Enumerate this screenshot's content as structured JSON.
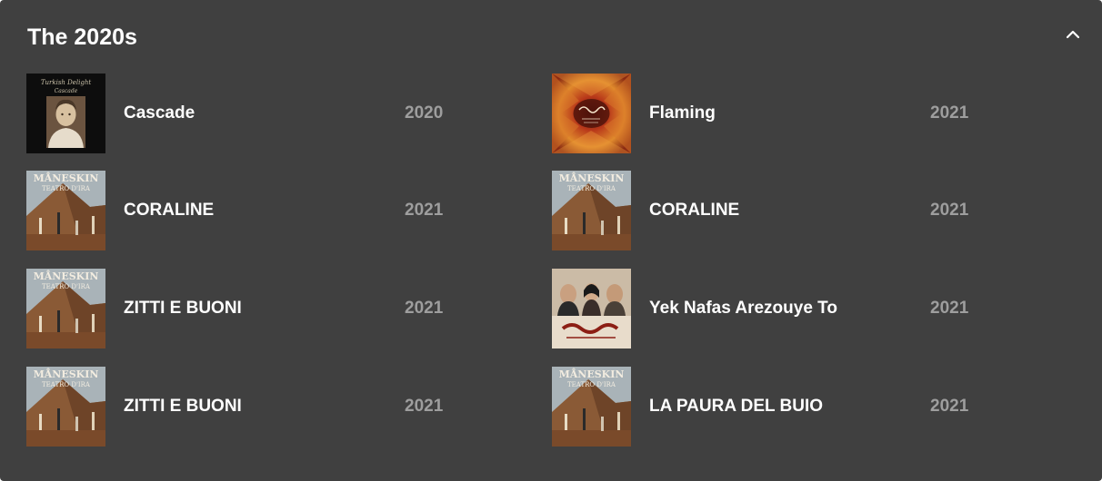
{
  "section": {
    "title": "The 2020s",
    "collapse_icon": "chevron-up-icon"
  },
  "colors": {
    "panel_bg": "#404040",
    "title_text": "#ffffff",
    "year_text": "#9e9e9e"
  },
  "tracks": [
    {
      "title": "Cascade",
      "year": "2020",
      "cover": "turkish-delight-cover",
      "cover_text_1": "Turkish Delight",
      "cover_text_2": "Cascade"
    },
    {
      "title": "Flaming",
      "year": "2021",
      "cover": "flaming-cover"
    },
    {
      "title": "CORALINE",
      "year": "2021",
      "cover": "maneskin-teatro-dira-cover",
      "cover_text_1": "MÅNESKIN",
      "cover_text_2": "TEATRO D'IRA"
    },
    {
      "title": "CORALINE",
      "year": "2021",
      "cover": "maneskin-teatro-dira-cover",
      "cover_text_1": "MÅNESKIN",
      "cover_text_2": "TEATRO D'IRA"
    },
    {
      "title": "ZITTI E BUONI",
      "year": "2021",
      "cover": "maneskin-teatro-dira-cover",
      "cover_text_1": "MÅNESKIN",
      "cover_text_2": "TEATRO D'IRA"
    },
    {
      "title": "Yek Nafas Arezouye To",
      "year": "2021",
      "cover": "yek-nafas-cover"
    },
    {
      "title": "ZITTI E BUONI",
      "year": "2021",
      "cover": "maneskin-teatro-dira-cover",
      "cover_text_1": "MÅNESKIN",
      "cover_text_2": "TEATRO D'IRA"
    },
    {
      "title": "LA PAURA DEL BUIO",
      "year": "2021",
      "cover": "maneskin-teatro-dira-cover",
      "cover_text_1": "MÅNESKIN",
      "cover_text_2": "TEATRO D'IRA"
    }
  ]
}
